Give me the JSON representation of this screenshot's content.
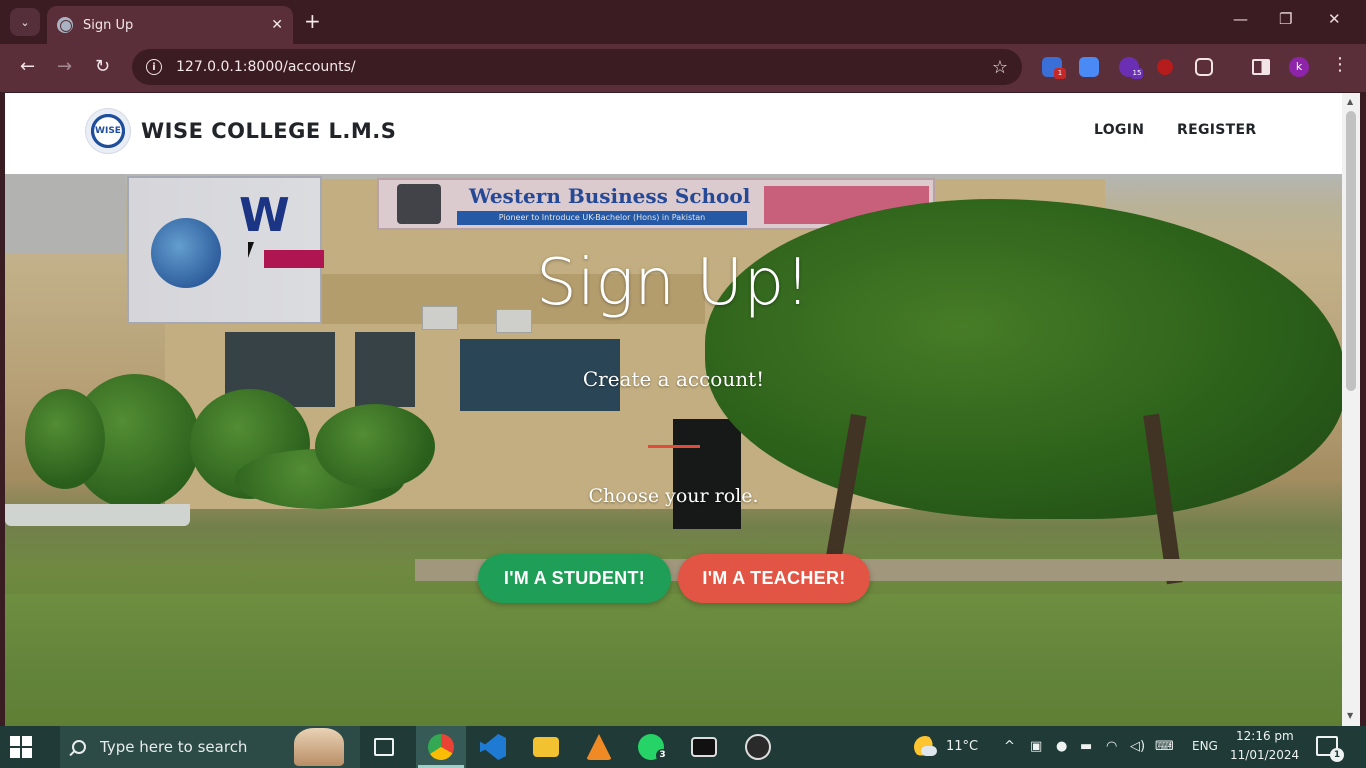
{
  "browser": {
    "tab_title": "Sign Up",
    "tab_close": "✕",
    "new_tab": "+",
    "url": "127.0.0.1:8000/accounts/",
    "back": "←",
    "forward": "→",
    "reload": "↻",
    "star": "☆",
    "extensions": [
      {
        "name": "extension-chrome-icon",
        "color": "#3b6fd8",
        "badge": "1"
      },
      {
        "name": "extension-translate-icon",
        "color": "#4a8af4",
        "badge": ""
      },
      {
        "name": "extension-purple-icon",
        "color": "#6b2fb3",
        "badge": "15"
      },
      {
        "name": "extension-ublock-icon",
        "color": "#b71c1c",
        "badge": ""
      }
    ],
    "profile_initial": "k",
    "window_controls": {
      "minimize": "—",
      "restore": "❐",
      "close": "✕"
    }
  },
  "site": {
    "brand": "WISE COLLEGE L.M.S",
    "logo_text": "WISE",
    "nav": {
      "login": "LOGIN",
      "register": "REGISTER"
    }
  },
  "hero": {
    "title": "Sign Up!",
    "subtitle": "Create a account!",
    "role_prompt": "Choose your role.",
    "student_button": "I'M A STUDENT!",
    "teacher_button": "I'M A TEACHER!",
    "banner_school": "Western Business School",
    "banner_tagline": "Pioneer to Introduce UK-Bachelor (Hons) in Pakistan",
    "banner_letters": "W"
  },
  "colors": {
    "student": "#1e9e57",
    "teacher": "#e25443",
    "accent_line": "#e04b3a"
  },
  "taskbar": {
    "search_placeholder": "Type here to search",
    "temperature": "11°C",
    "language": "ENG",
    "time": "12:16 pm",
    "date": "11/01/2024",
    "whatsapp_badge": "3",
    "notification_count": "1",
    "tray_up": "^"
  }
}
